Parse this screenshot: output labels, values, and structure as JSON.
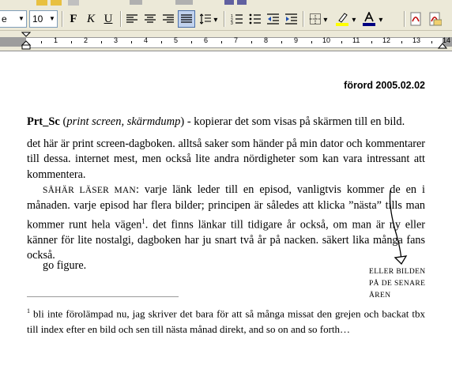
{
  "toolbar": {
    "font_name_value": "e",
    "font_size_value": "10",
    "bold_label": "F",
    "italic_label": "K",
    "underline_label": "U",
    "line_spacing_arrow": "▾",
    "colors": {
      "highlight": "#ffff00",
      "font_color": "#000080"
    }
  },
  "ruler": {
    "numbers": [
      "1",
      "2",
      "3",
      "4",
      "5",
      "6",
      "7",
      "8",
      "9",
      "10",
      "11",
      "12",
      "13",
      "14"
    ]
  },
  "document": {
    "header_date": "förord 2005.02.02",
    "intro": {
      "term": "Prt_Sc",
      "open_paren": " (",
      "gloss": "print screen, skärmdump",
      "rest": ") - kopierar det som visas på skärmen till en bild."
    },
    "paragraph1": "det här är print screen-dagboken. alltså saker som händer på min dator och kommentarer till dessa. internet mest, men också lite andra nördigheter som kan vara intressant att kommentera.",
    "paragraph2": {
      "lead": "SÅHÄR LÄSER MAN",
      "text_before_footnote": ": varje länk leder till en episod, vanligtvis kommer de en i månaden. varje episod har flera bilder; principen är således att klicka ”nästa” tills man kommer runt hela vägen",
      "footnote_mark": "1",
      "text_after_footnote": ". det finns länkar till tidigare år också, om man är ny eller känner för lite nostalgi, dagboken har ju snart två år på nacken. säkert lika många fans också."
    },
    "paragraph3": "go figure.",
    "annotation_lines": [
      "ELLER BILDEN",
      "PÅ DE SENARE",
      "ÅREN"
    ],
    "footnote": {
      "mark": "1",
      "text": " bli inte förolämpad nu, jag skriver det bara för att så många missat den grejen och backat tbx till index efter en bild och sen till nästa månad direkt, and so on and so forth…"
    }
  }
}
